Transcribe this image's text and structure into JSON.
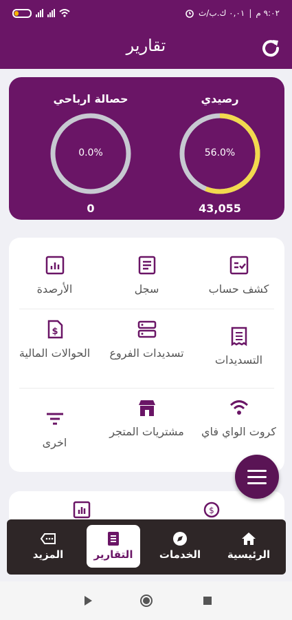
{
  "status_bar": {
    "time": "٩:٠٢ م",
    "data_speed": "٠,٠١ ك.ب/ث",
    "battery_level": 0.25
  },
  "app_bar": {
    "title": "تقارير"
  },
  "stats": {
    "balance": {
      "label": "رصيدي",
      "percent_text": "56.0%",
      "percent": 56.0,
      "value": "43,055",
      "ring_color": "#f2d94e"
    },
    "profit": {
      "label": "حصالة ارباحي",
      "percent_text": "0.0%",
      "percent": 0.0,
      "value": "0",
      "ring_color": "#f2d94e"
    }
  },
  "menu": {
    "items": [
      {
        "label": "كشف حساب",
        "icon": "checklist-icon"
      },
      {
        "label": "سجل",
        "icon": "document-icon"
      },
      {
        "label": "الأرصدة",
        "icon": "chart-icon"
      },
      {
        "label": "التسديدات",
        "icon": "receipt-icon"
      },
      {
        "label": "تسديدات الفروع",
        "icon": "server-icon"
      },
      {
        "label": "الحوالات المالية",
        "icon": "money-file-icon"
      },
      {
        "label": "كروت الواي فاي",
        "icon": "wifi-icon"
      },
      {
        "label": "مشتريات المتجر",
        "icon": "store-icon"
      },
      {
        "label": "اخرى",
        "icon": "filter-icon"
      }
    ]
  },
  "bottom_nav": {
    "home": "الرئيسية",
    "services": "الخدمات",
    "reports": "التقارير",
    "more": "المزيد",
    "active": "reports"
  },
  "colors": {
    "primary": "#6a1566",
    "accent": "#f2d94e",
    "ring_track": "#c7c9d1",
    "nav_bg": "#2e2627"
  }
}
